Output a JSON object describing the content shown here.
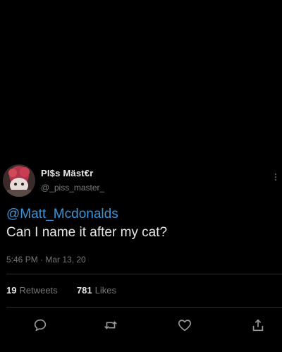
{
  "tweet": {
    "display_name": "PI$s Mäst€r",
    "handle": "@_piss_master_",
    "mention": "@Matt_Mcdonalds",
    "message": "Can I name it after my cat?",
    "timestamp": "5:46 PM · Mar 13, 20",
    "retweets_count": "19",
    "retweets_label": "Retweets",
    "likes_count": "781",
    "likes_label": "Likes"
  },
  "icons": {
    "reply": "reply-icon",
    "retweet": "retweet-icon",
    "like": "like-icon",
    "share": "share-icon",
    "more": "more-icon"
  },
  "colors": {
    "background": "#000000",
    "mention": "#3b94d9",
    "muted": "#777777"
  }
}
